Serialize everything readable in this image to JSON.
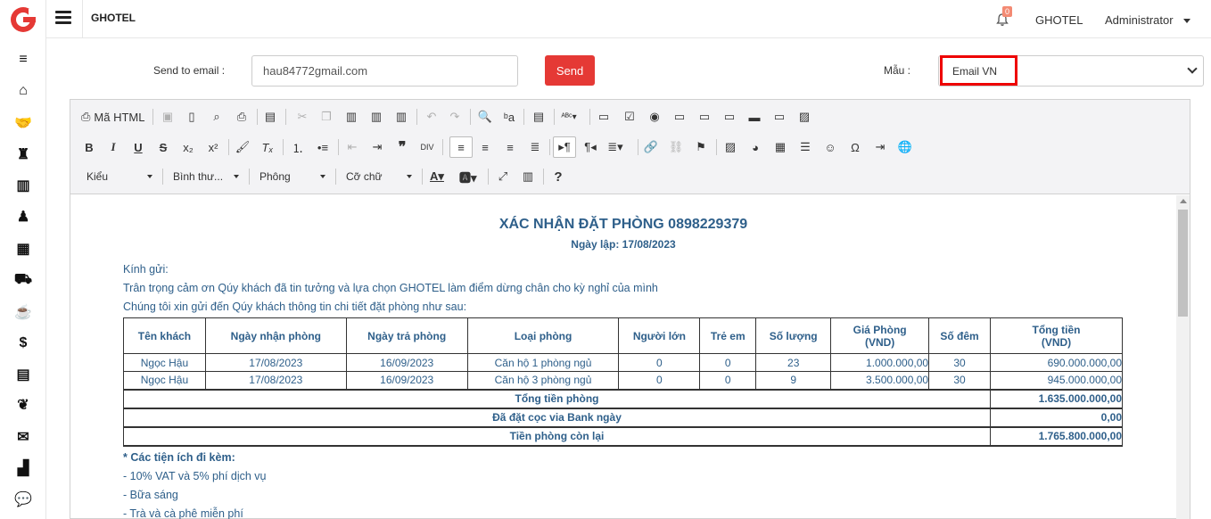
{
  "app": {
    "title": "GHOTEL"
  },
  "header": {
    "notifications": "0",
    "hotel": "GHOTEL",
    "user": "Administrator"
  },
  "form": {
    "email_label": "Send to email :",
    "email_value": "hau84772gmail.com",
    "send_label": "Send",
    "template_label": "Mẫu :",
    "template_value": "Email VN"
  },
  "toolbar": {
    "source_label": "Mã HTML",
    "style_combo": "Kiểu",
    "format_combo": "Bình thư...",
    "font_combo": "Phông",
    "size_combo": "Cỡ chữ"
  },
  "document": {
    "title": "XÁC NHẬN ĐẶT PHÒNG 0898229379",
    "date_line": "Ngày lập: 17/08/2023",
    "greeting": "Kính gửi:",
    "line1": "Trân trọng cảm ơn Qúy khách đã tin tưởng và lựa chọn GHOTEL làm điểm dừng chân cho kỳ nghỉ của mình",
    "line2": "Chúng tôi xin gửi đến Qúy khách thông tin chi tiết đặt phòng như sau:",
    "table": {
      "headers": [
        "Tên khách",
        "Ngày nhận phòng",
        "Ngày trả phòng",
        "Loại phòng",
        "Người lớn",
        "Trẻ em",
        "Số lượng",
        "Giá Phòng\n(VND)",
        "Số đêm",
        "Tổng tiền\n(VND)"
      ],
      "rows": [
        [
          "Ngọc Hậu",
          "17/08/2023",
          "16/09/2023",
          "Căn hộ 1 phòng ngủ",
          "0",
          "0",
          "23",
          "1.000.000,00",
          "30",
          "690.000.000,00"
        ],
        [
          "Ngọc Hậu",
          "17/08/2023",
          "16/09/2023",
          "Căn hộ 3 phòng ngủ",
          "0",
          "0",
          "9",
          "3.500.000,00",
          "30",
          "945.000.000,00"
        ]
      ],
      "summary": [
        {
          "label": "Tổng tiền phòng",
          "value": "1.635.000.000,00"
        },
        {
          "label": "Đã đặt cọc via Bank ngày",
          "value": "0,00"
        },
        {
          "label": "Tiền phòng còn lại",
          "value": "1.765.800.000,00"
        }
      ]
    },
    "amenities_title": "* Các tiện ích đi kèm:",
    "amenities": [
      "- 10% VAT và 5% phí dịch vụ",
      "- Bữa sáng",
      "- Trà và cà phê miễn phí"
    ]
  },
  "colors": {
    "accent": "#e53935",
    "doc_text": "#2e5f8a",
    "highlight": "#ee0000"
  }
}
